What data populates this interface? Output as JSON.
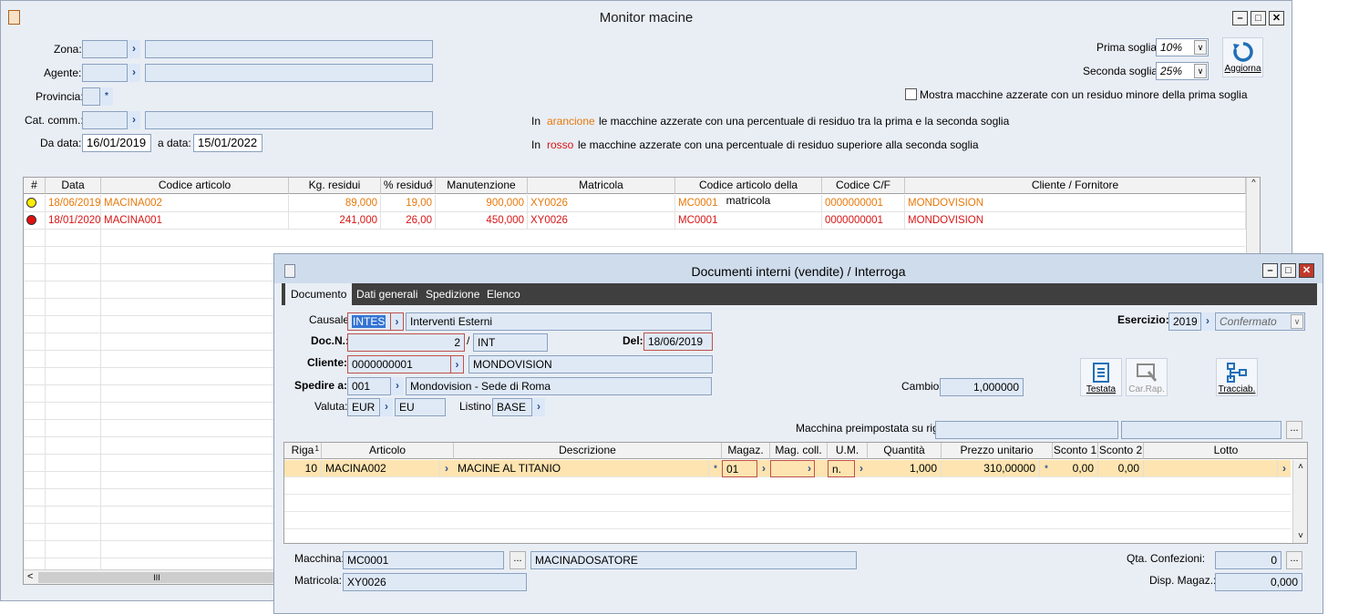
{
  "monitor": {
    "title": "Monitor macine",
    "zona_label": "Zona:",
    "agente_label": "Agente:",
    "provincia_label": "Provincia:",
    "cat_label": "Cat. comm.:",
    "da_data_label": "Da data:",
    "da_data": "16/01/2019",
    "a_data_label": "a data:",
    "a_data": "15/01/2022",
    "prima_soglia_label": "Prima soglia:",
    "prima_soglia": "10%",
    "seconda_soglia_label": "Seconda soglia:",
    "seconda_soglia": "25%",
    "aggiorna_label": "Aggiorna",
    "checkbox_label": "Mostra macchine azzerate con un residuo minore della prima soglia",
    "legend1_prefix": "In",
    "legend1_color_word": "arancione",
    "legend1_text": "le macchine azzerate con una percentuale di residuo tra la prima e la seconda soglia",
    "legend2_prefix": "In",
    "legend2_color_word": "rosso",
    "legend2_text": "le macchine azzerate con una percentuale di residuo superiore alla seconda soglia",
    "columns": [
      "#",
      "Data",
      "Codice articolo",
      "Kg. residui",
      "% residuo",
      "Manutenzione",
      "Matricola",
      "Codice articolo della matricola",
      "Codice C/F",
      "Cliente / Fornitore"
    ],
    "sort_badge": "1",
    "rows": [
      {
        "color": "#e8780a",
        "dot": "#ffee00",
        "data": "18/06/2019",
        "codice": "MACINA002",
        "kg": "89,000",
        "perc": "19,00",
        "manut": "900,000",
        "matricola": "XY0026",
        "cod_matr": "MC0001",
        "cf": "0000000001",
        "cliente": "MONDOVISION"
      },
      {
        "color": "#d81515",
        "dot": "#e01010",
        "data": "18/01/2020",
        "codice": "MACINA001",
        "kg": "241,000",
        "perc": "26,00",
        "manut": "450,000",
        "matricola": "XY0026",
        "cod_matr": "MC0001",
        "cf": "0000000001",
        "cliente": "MONDOVISION"
      }
    ],
    "scroll_glyph": "III"
  },
  "documenti": {
    "title": "Documenti interni (vendite) / Interroga",
    "tabs": [
      "Documento",
      "Dati generali",
      "Spedizione",
      "Elenco"
    ],
    "causale_label": "Causale:",
    "causale_code": "INTES",
    "causale_desc": "Interventi Esterni",
    "esercizio_label": "Esercizio:",
    "esercizio": "2019",
    "stato": "Confermato",
    "docn_label": "Doc.N.:",
    "docn": "2",
    "docn_serie": "INT",
    "del_label": "Del:",
    "del_date": "18/06/2019",
    "cliente_label": "Cliente:",
    "cliente_code": "0000000001",
    "cliente_name": "MONDOVISION",
    "spedire_label": "Spedire a:",
    "spedire_code": "001",
    "spedire_desc": "Mondovision - Sede di Roma",
    "valuta_label": "Valuta:",
    "valuta": "EUR",
    "valuta_desc": "EU",
    "listino_label": "Listino:",
    "listino": "BASE",
    "cambio_label": "Cambio:",
    "cambio": "1,000000",
    "testata_label": "Testata",
    "carrap_label": "Car.Rap.",
    "tracciab_label": "Tracciab.",
    "macchina_riga_label": "Macchina preimpostata su riga:",
    "columns": [
      "Riga",
      "Articolo",
      "Descrizione",
      "Magaz.",
      "Mag. coll.",
      "U.M.",
      "Quantità",
      "Prezzo unitario",
      "Sconto 1",
      "Sconto 2",
      "Lotto"
    ],
    "sort_badge": "1",
    "row": {
      "riga": "10",
      "articolo": "MACINA002",
      "descrizione": "MACINE AL TITANIO",
      "magaz": "01",
      "magcoll": "",
      "um": "n.",
      "quantita": "1,000",
      "prezzo": "310,00000",
      "sconto1": "0,00",
      "sconto2": "0,00",
      "lotto": ""
    },
    "macchina_label": "Macchina:",
    "macchina": "MC0001",
    "macchina_desc": "MACINADOSATORE",
    "matricola_label": "Matricola:",
    "matricola": "XY0026",
    "qta_label": "Qta. Confezioni:",
    "qta": "0",
    "disp_label": "Disp. Magaz.:",
    "disp": "0,000"
  }
}
